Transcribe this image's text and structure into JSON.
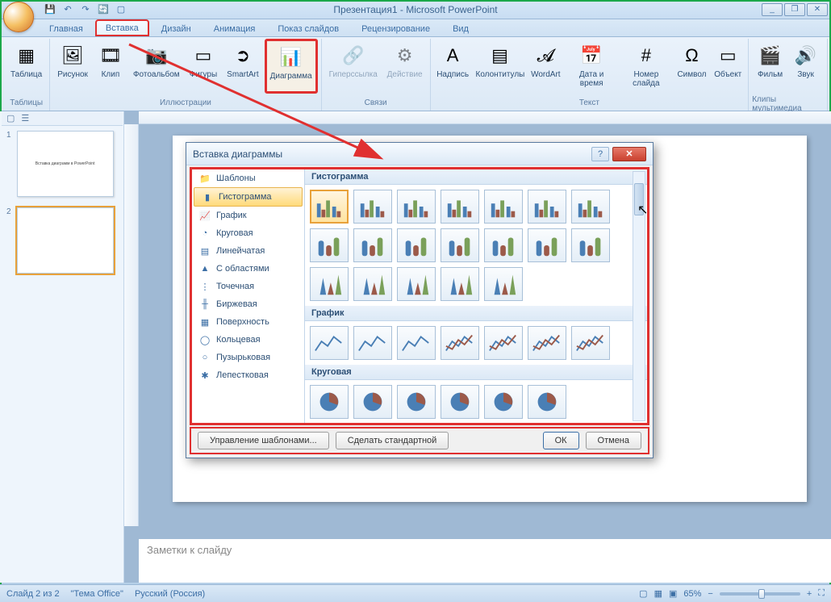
{
  "title": "Презентация1 - Microsoft PowerPoint",
  "qat": {
    "save": "💾",
    "undo": "↶",
    "redo": "↷",
    "repeat": "🔄",
    "slideshow": "▢"
  },
  "win": {
    "min": "_",
    "max": "❐",
    "close": "✕"
  },
  "tabs": [
    "Главная",
    "Вставка",
    "Дизайн",
    "Анимация",
    "Показ слайдов",
    "Рецензирование",
    "Вид"
  ],
  "ribbon": {
    "groups": [
      {
        "label": "Таблицы",
        "items": [
          {
            "label": "Таблица",
            "icon": "▦"
          }
        ]
      },
      {
        "label": "Иллюстрации",
        "items": [
          {
            "label": "Рисунок",
            "icon": "🖼"
          },
          {
            "label": "Клип",
            "icon": "🎞"
          },
          {
            "label": "Фотоальбом",
            "icon": "📷"
          },
          {
            "label": "Фигуры",
            "icon": "▭"
          },
          {
            "label": "SmartArt",
            "icon": "➲"
          },
          {
            "label": "Диаграмма",
            "icon": "📊",
            "hl": true
          }
        ]
      },
      {
        "label": "Связи",
        "items": [
          {
            "label": "Гиперссылка",
            "icon": "🔗",
            "dis": true
          },
          {
            "label": "Действие",
            "icon": "⚙",
            "dis": true
          }
        ]
      },
      {
        "label": "Текст",
        "items": [
          {
            "label": "Надпись",
            "icon": "A"
          },
          {
            "label": "Колонтитулы",
            "icon": "▤"
          },
          {
            "label": "WordArt",
            "icon": "𝓐"
          },
          {
            "label": "Дата и время",
            "icon": "📅"
          },
          {
            "label": "Номер слайда",
            "icon": "#"
          },
          {
            "label": "Символ",
            "icon": "Ω"
          },
          {
            "label": "Объект",
            "icon": "▭"
          }
        ]
      },
      {
        "label": "Клипы мультимедиа",
        "items": [
          {
            "label": "Фильм",
            "icon": "🎬"
          },
          {
            "label": "Звук",
            "icon": "🔊"
          }
        ]
      }
    ]
  },
  "thumbs": [
    {
      "num": "1",
      "text": "Вставка диаграмм в PowerPoint"
    },
    {
      "num": "2",
      "text": ""
    }
  ],
  "notes_placeholder": "Заметки к слайду",
  "dialog": {
    "title": "Вставка диаграммы",
    "help": "?",
    "close": "✕",
    "categories": [
      {
        "label": "Шаблоны",
        "icon": "📁"
      },
      {
        "label": "Гистограмма",
        "icon": "▮",
        "sel": true
      },
      {
        "label": "График",
        "icon": "📈"
      },
      {
        "label": "Круговая",
        "icon": "◔"
      },
      {
        "label": "Линейчатая",
        "icon": "▤"
      },
      {
        "label": "С областями",
        "icon": "▲"
      },
      {
        "label": "Точечная",
        "icon": "⋮"
      },
      {
        "label": "Биржевая",
        "icon": "╫"
      },
      {
        "label": "Поверхность",
        "icon": "▦"
      },
      {
        "label": "Кольцевая",
        "icon": "◯"
      },
      {
        "label": "Пузырьковая",
        "icon": "○"
      },
      {
        "label": "Лепестковая",
        "icon": "✱"
      }
    ],
    "sections": [
      {
        "label": "Гистограмма",
        "count": 19
      },
      {
        "label": "График",
        "count": 7
      },
      {
        "label": "Круговая",
        "count": 6
      }
    ],
    "footer": {
      "manage": "Управление шаблонами...",
      "default": "Сделать стандартной",
      "ok": "ОК",
      "cancel": "Отмена"
    }
  },
  "status": {
    "slide": "Слайд 2 из 2",
    "theme": "\"Тема Office\"",
    "lang": "Русский (Россия)",
    "zoom": "65%"
  }
}
